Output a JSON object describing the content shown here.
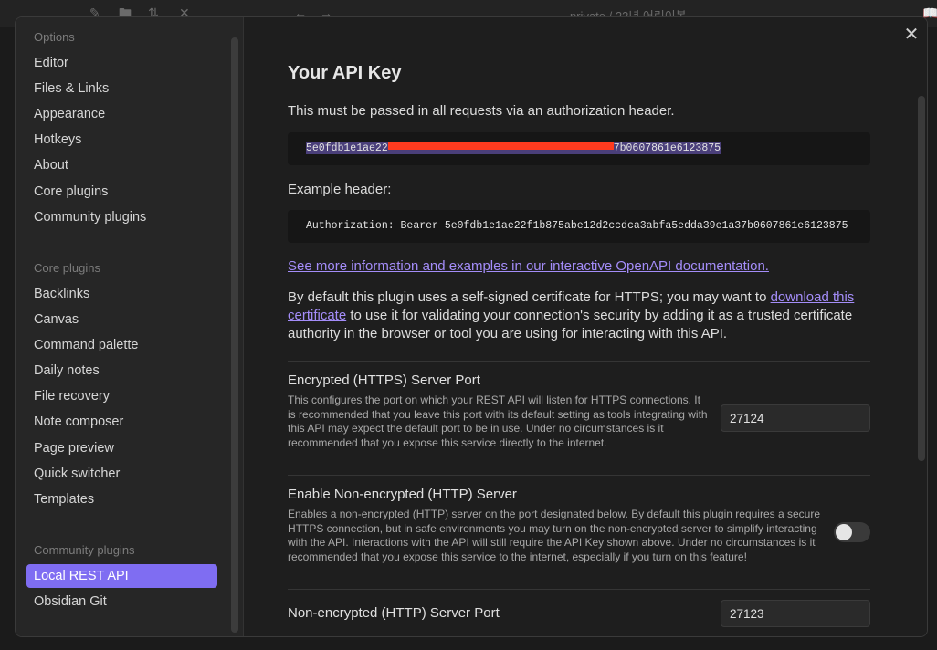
{
  "app_bar": {
    "breadcrumb": "private / 23년 어린이봅"
  },
  "sidebar": {
    "groups": [
      {
        "title": "Options",
        "items": [
          "Editor",
          "Files & Links",
          "Appearance",
          "Hotkeys",
          "About",
          "Core plugins",
          "Community plugins"
        ]
      },
      {
        "title": "Core plugins",
        "items": [
          "Backlinks",
          "Canvas",
          "Command palette",
          "Daily notes",
          "File recovery",
          "Note composer",
          "Page preview",
          "Quick switcher",
          "Templates"
        ]
      },
      {
        "title": "Community plugins",
        "items": [
          "Local REST API",
          "Obsidian Git"
        ]
      }
    ],
    "active_item": "Local REST API"
  },
  "content": {
    "title": "Your API Key",
    "key_intro": "This must be passed in all requests via an authorization header.",
    "api_key_start": "5e0fdb1e1ae22",
    "api_key_end": "7b0607861e6123875",
    "example_label": "Example header:",
    "example_header": "Authorization: Bearer 5e0fdb1e1ae22f1b875abe12d2ccdca3abfa5edda39e1a37b0607861e6123875",
    "docs_link": "See more information and examples in our interactive OpenAPI documentation.",
    "cert_text_before": "By default this plugin uses a self-signed certificate for HTTPS; you may want to ",
    "cert_link": "download this certificate",
    "cert_text_after": " to use it for validating your connection's security by adding it as a trusted certificate authority in the browser or tool you are using for interacting with this API.",
    "settings": {
      "https_port": {
        "name": "Encrypted (HTTPS) Server Port",
        "desc": "This configures the port on which your REST API will listen for HTTPS connections. It is recommended that you leave this port with its default setting as tools integrating with this API may expect the default port to be in use. Under no circumstances is it recommended that you expose this service directly to the internet.",
        "value": "27124"
      },
      "http_enable": {
        "name": "Enable Non-encrypted (HTTP) Server",
        "desc": "Enables a non-encrypted (HTTP) server on the port designated below. By default this plugin requires a secure HTTPS connection, but in safe environments you may turn on the non-encrypted server to simplify interacting with the API. Interactions with the API will still require the API Key shown above. Under no circumstances is it recommended that you expose this service to the internet, especially if you turn on this feature!",
        "enabled": false
      },
      "http_port": {
        "name": "Non-encrypted (HTTP) Server Port",
        "value": "27123"
      }
    }
  },
  "colors": {
    "accent": "#7f6df2",
    "link": "#a48df9",
    "redaction": "#ff3b1f"
  }
}
